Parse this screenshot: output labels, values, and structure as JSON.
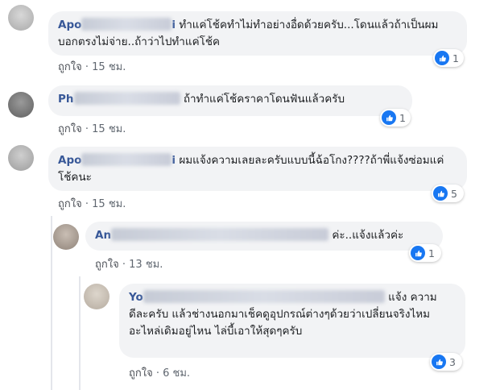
{
  "comments": [
    {
      "author_visible": "Apo",
      "author_visible_end": "i",
      "text": "ทำแค่โช้คทำไม่ทำอย่างอื่ดด้วยครับ...โดนแล้วถ้าเป็นผมบอกตรงไม่จ่าย..ถ้าว่าไปทำแค่โช้ค",
      "like_label": "ถูกใจ",
      "separator": "·",
      "time": "15 ชม.",
      "reaction_count": "1",
      "reaction_icon": "like-icon"
    },
    {
      "author_visible": "Ph",
      "text": "ถ้าทำแค่โช้คราคาโดนฟันแล้วครับ",
      "like_label": "ถูกใจ",
      "separator": "·",
      "time": "15 ชม.",
      "reaction_count": "1",
      "reaction_icon": "like-icon"
    },
    {
      "author_visible": "Apo",
      "author_visible_end": "i",
      "text": "ผมแจ้งความเลยละครับแบบนี้ฉ้อโกง????ถ้าพี่แจ้งซ่อมแค่โช้คนะ",
      "like_label": "ถูกใจ",
      "separator": "·",
      "time": "15 ชม.",
      "reaction_count": "5",
      "reaction_icon": "like-icon"
    },
    {
      "author_visible": "An",
      "text": "ค่ะ..แจ้งแล้วค่ะ",
      "like_label": "ถูกใจ",
      "separator": "·",
      "time": "13 ชม.",
      "reaction_count": "1",
      "reaction_icon": "like-icon"
    },
    {
      "author_visible": "Yo",
      "text_first": "แจ้ง",
      "text": "ความดีละครับ แล้วช่างนอกมาเช็คดูอุปกรณ์ต่างๆด้วยว่าเปลี่ยนจริงไหม อะไหล่เดิมอยู่ไหน ไล่บี้เอาให้สุดๆครับ",
      "like_label": "ถูกใจ",
      "separator": "·",
      "time": "6 ชม.",
      "reaction_count": "3",
      "reaction_icon": "like-icon"
    }
  ],
  "colors": {
    "bubble": "#f2f3f5",
    "name": "#385898",
    "like_blue": "#1877f2",
    "meta": "#606770"
  }
}
